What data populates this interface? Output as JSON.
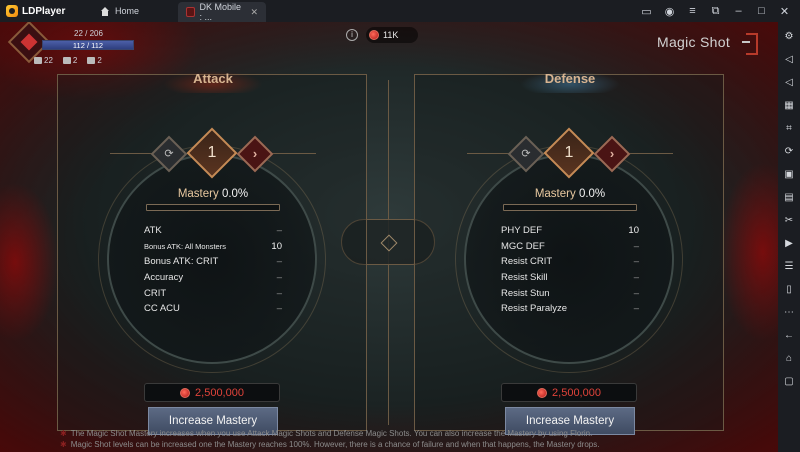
{
  "emulator": {
    "brand": "LDPlayer",
    "tabs": [
      {
        "label": "Home"
      },
      {
        "label": "DK Mobile : ...",
        "close": "✕"
      }
    ]
  },
  "hud": {
    "xp_text": "22 / 206",
    "hp_text": "112 / 112",
    "hp_fraction": 1.0,
    "stats": [
      "22",
      "2",
      "2"
    ]
  },
  "top": {
    "currency": "11K"
  },
  "page_title": "Magic Shot",
  "attack": {
    "title": "Attack",
    "level": "1",
    "mastery_label": "Mastery",
    "mastery_value": "0.0%",
    "mastery_fraction": 0.0,
    "stats": [
      {
        "name": "ATK",
        "value": "–"
      },
      {
        "name": "Bonus ATK: All Monsters",
        "value": "10"
      },
      {
        "name": "Bonus ATK: CRIT",
        "value": "–"
      },
      {
        "name": "Accuracy",
        "value": "–"
      },
      {
        "name": "CRIT",
        "value": "–"
      },
      {
        "name": "CC ACU",
        "value": "–"
      }
    ],
    "cost": "2,500,000",
    "button": "Increase Mastery"
  },
  "defense": {
    "title": "Defense",
    "level": "1",
    "mastery_label": "Mastery",
    "mastery_value": "0.0%",
    "mastery_fraction": 0.0,
    "stats": [
      {
        "name": "PHY DEF",
        "value": "10"
      },
      {
        "name": "MGC DEF",
        "value": "–"
      },
      {
        "name": "Resist CRIT",
        "value": "–"
      },
      {
        "name": "Resist Skill",
        "value": "–"
      },
      {
        "name": "Resist Stun",
        "value": "–"
      },
      {
        "name": "Resist Paralyze",
        "value": "–"
      }
    ],
    "cost": "2,500,000",
    "button": "Increase Mastery"
  },
  "notes": [
    "The Magic Shot Mastery increases when you use Attack Magic Shots and Defense Magic Shots. You can also increase the Mastery by using Florin.",
    "Magic Shot levels can be increased one the Mastery reaches 100%. However, there is a chance of failure and when that happens, the Mastery drops."
  ],
  "colors": {
    "accent_red": "#e0433a",
    "mastery_gold": "#e9c9a0",
    "frame": "#6b5a44"
  }
}
